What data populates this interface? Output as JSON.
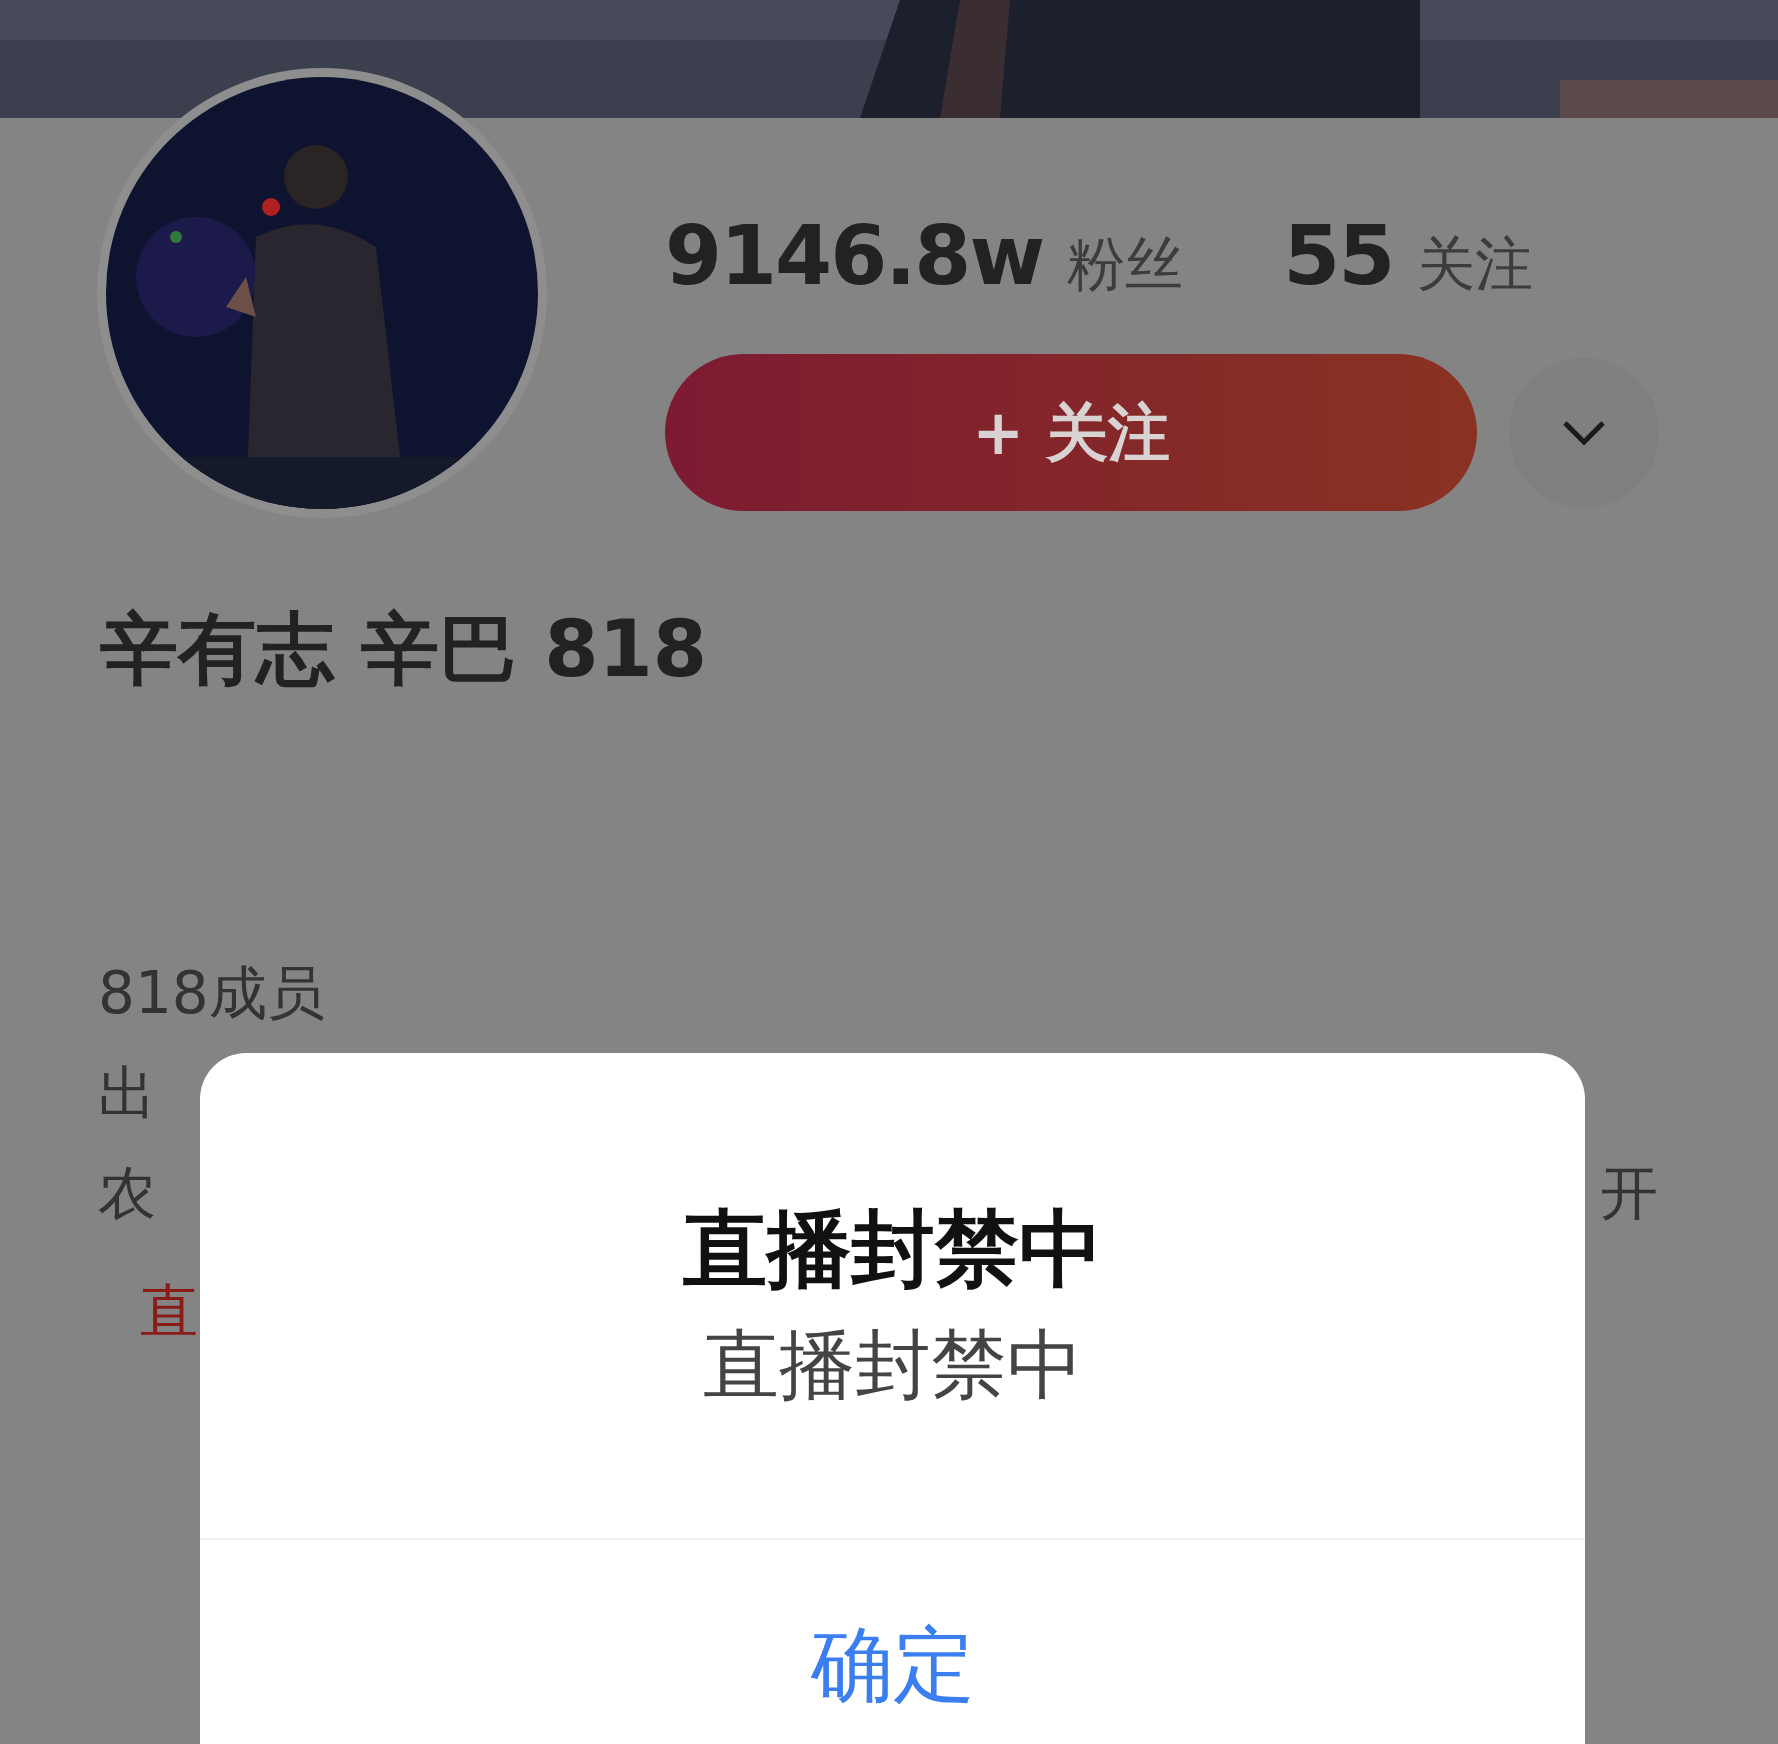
{
  "profile": {
    "followers_count": "9146.8w",
    "followers_label": "粉丝",
    "following_count": "55",
    "following_label": "关注",
    "follow_button": "+ 关注",
    "name": "辛有志 辛巴 818"
  },
  "bio": {
    "lines": [
      "818成员",
      "出"
    ],
    "last_line_left": "农",
    "last_line_right": "开",
    "live_tag": "直"
  },
  "dialog": {
    "title": "直播封禁中",
    "message": "直播封禁中",
    "confirm": "确定"
  }
}
